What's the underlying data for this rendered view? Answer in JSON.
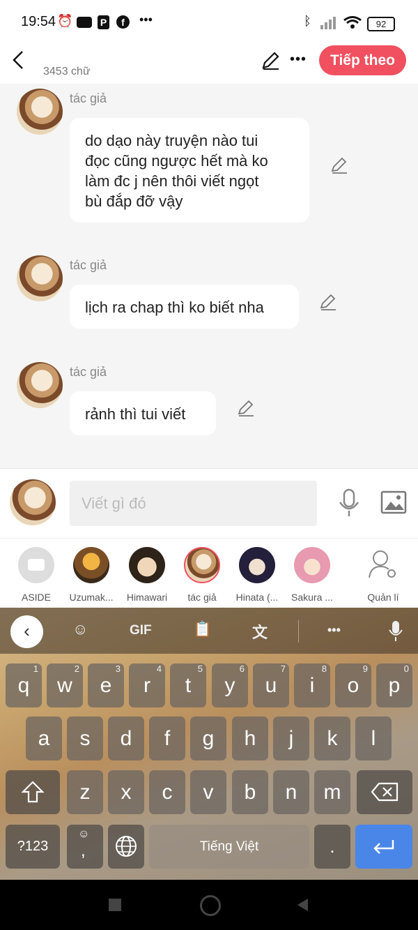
{
  "status_bar": {
    "time": "19:54",
    "battery": "92"
  },
  "header": {
    "word_count": "3453 chữ",
    "next_label": "Tiếp theo"
  },
  "messages": [
    {
      "author": "tác giả",
      "lines": [
        "do dạo này truyện nào tui",
        "đọc cũng ngược hết mà ko",
        "làm đc j nên thôi viết ngọt",
        "bù đắp đỡ vậy"
      ]
    },
    {
      "author": "tác giả",
      "lines": [
        "lịch ra chap thì ko biết nha"
      ]
    },
    {
      "author": "tác giả",
      "lines": [
        "rảnh thì tui viết"
      ]
    }
  ],
  "composer": {
    "placeholder": "Viết gì đó"
  },
  "characters": [
    {
      "name": "ASIDE",
      "color": "#dcdcdc"
    },
    {
      "name": "Uzumak...",
      "color": "#c98a2c"
    },
    {
      "name": "Himawari",
      "color": "#3a2a1c"
    },
    {
      "name": "tác giả",
      "color": "#d9b58a"
    },
    {
      "name": "Hinata (...",
      "color": "#2a2440"
    },
    {
      "name": "Sakura ...",
      "color": "#e7a3b6"
    },
    {
      "name": "Quản lí",
      "color": "#ffffff"
    }
  ],
  "keyboard": {
    "toolbar": {
      "gif": "GIF",
      "more": "•••"
    },
    "row1": [
      [
        "q",
        "1"
      ],
      [
        "w",
        "2"
      ],
      [
        "e",
        "3"
      ],
      [
        "r",
        "4"
      ],
      [
        "t",
        "5"
      ],
      [
        "y",
        "6"
      ],
      [
        "u",
        "7"
      ],
      [
        "i",
        "8"
      ],
      [
        "o",
        "9"
      ],
      [
        "p",
        "0"
      ]
    ],
    "row2": [
      "a",
      "s",
      "d",
      "f",
      "g",
      "h",
      "j",
      "k",
      "l"
    ],
    "row3": [
      "z",
      "x",
      "c",
      "v",
      "b",
      "n",
      "m"
    ],
    "symbols": "?123",
    "comma": ",",
    "space": "Tiếng Việt",
    "period": "."
  }
}
